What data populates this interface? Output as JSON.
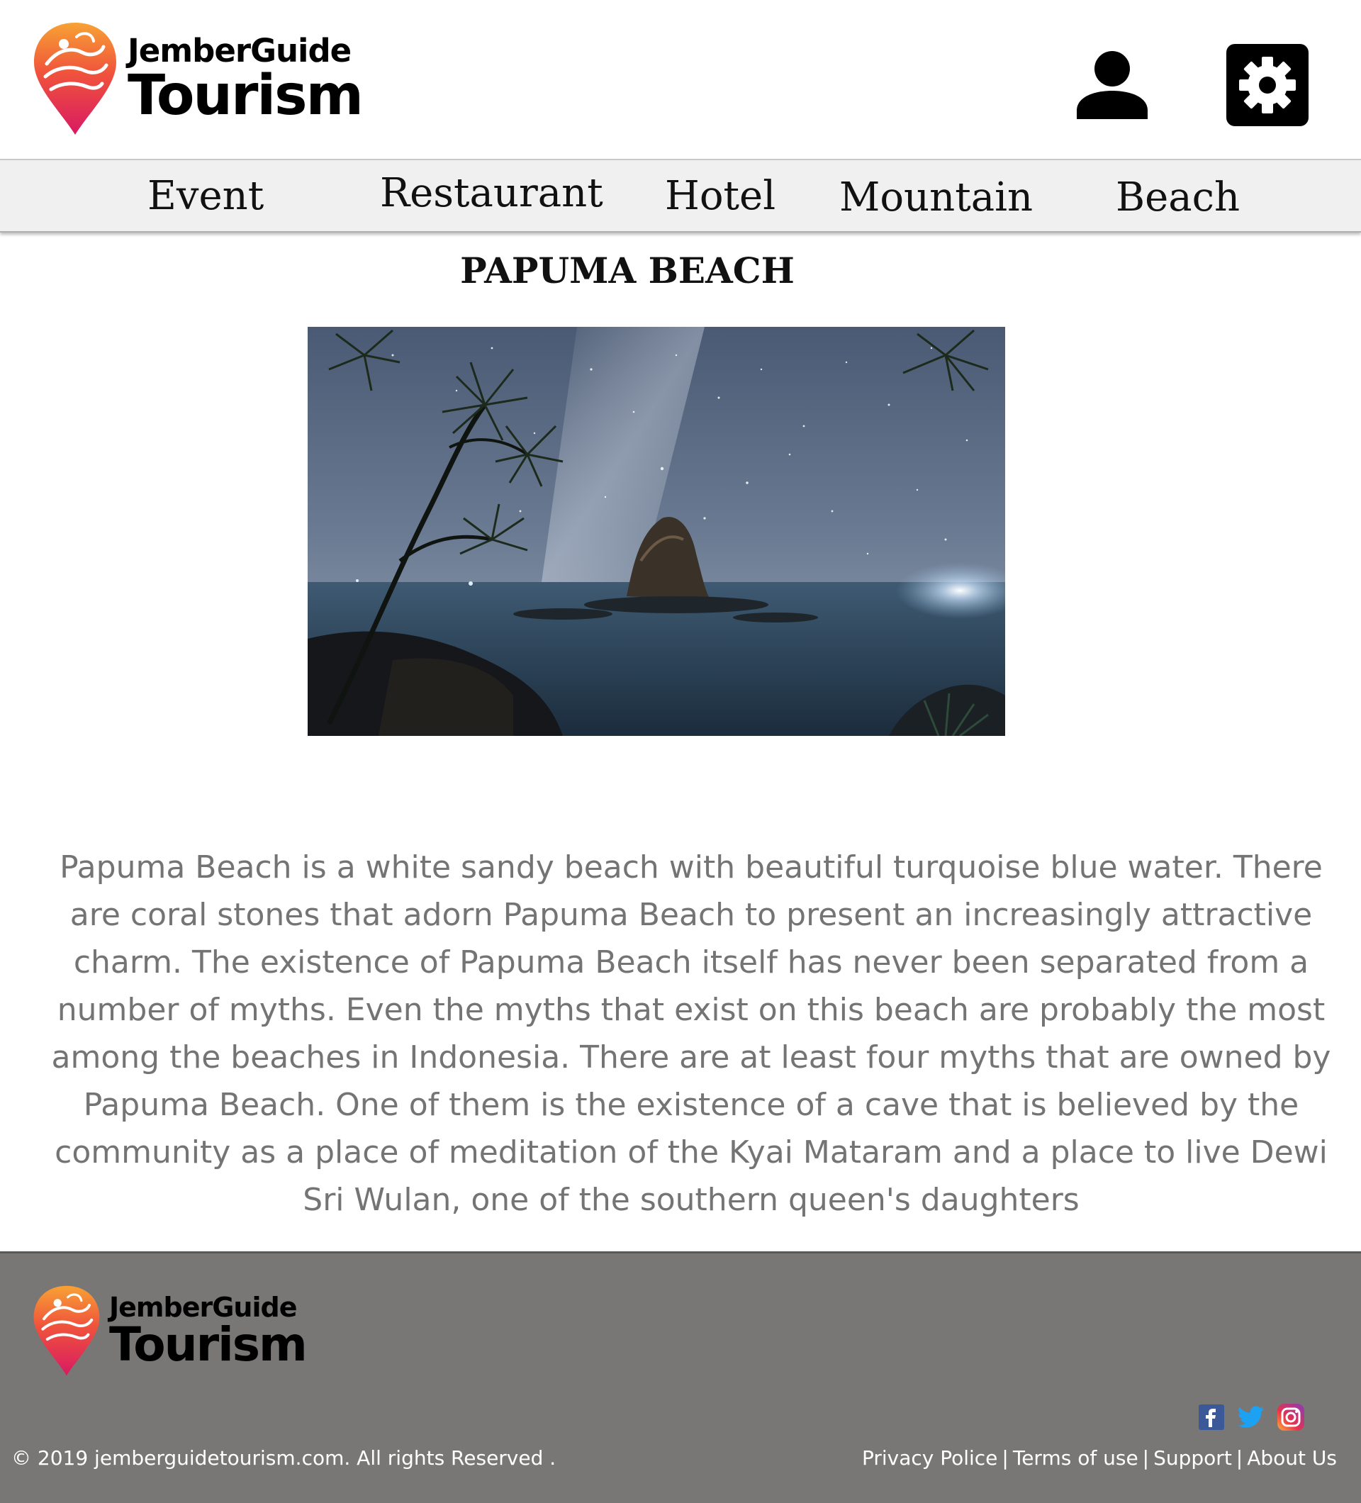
{
  "brand": {
    "line1": "JemberGuide",
    "line2": "Tourism"
  },
  "header": {
    "user_icon": "user-icon",
    "settings_icon": "gear-icon"
  },
  "nav": {
    "items": [
      {
        "label": "Event"
      },
      {
        "label": "Restaurant"
      },
      {
        "label": "Hotel"
      },
      {
        "label": "Mountain"
      },
      {
        "label": "Beach"
      }
    ]
  },
  "main": {
    "title": "PAPUMA BEACH",
    "description": "Papuma Beach is a white sandy beach with beautiful turquoise blue water. There are coral stones that adorn Papuma Beach to present an increasingly attractive charm. The existence of Papuma Beach itself has never been separated from a number of myths. Even the myths that exist on this beach are probably the most among the beaches in Indonesia. There are at least four myths that are owned by Papuma Beach. One of them is the existence of a cave that is believed by the community as a place of meditation of the Kyai Mataram and a place to live Dewi Sri Wulan, one of the southern queen's daughters"
  },
  "footer": {
    "copyright": "© 2019 jemberguidetourism.com. All rights Reserved .",
    "links": [
      "Privacy Police",
      "Terms of use",
      "Support",
      "About Us"
    ],
    "separator": "|",
    "social": [
      "facebook-icon",
      "twitter-icon",
      "instagram-icon"
    ]
  },
  "colors": {
    "nav_bg": "#f1f0f1",
    "footer_bg": "#797676",
    "description_text": "#747474",
    "logo_gradient_top": "#f7a234",
    "logo_gradient_bottom": "#e3145f"
  }
}
